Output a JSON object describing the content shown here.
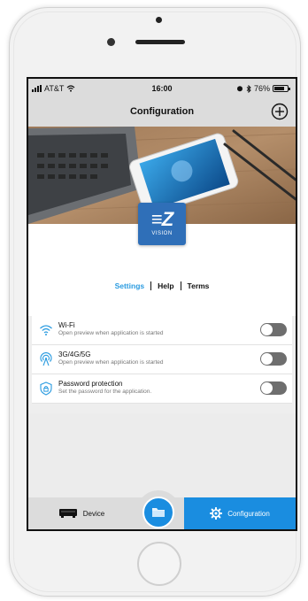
{
  "status_bar": {
    "carrier": "AT&T",
    "time": "16:00",
    "battery": "76%",
    "battery_level": 0.76
  },
  "header": {
    "title": "Configuration",
    "add_icon": "plus-circle-icon"
  },
  "logo": {
    "main": "≡Z",
    "sub": "VISION"
  },
  "tabs": [
    {
      "label": "Settings",
      "active": true
    },
    {
      "label": "Help",
      "active": false
    },
    {
      "label": "Terms",
      "active": false
    }
  ],
  "settings": [
    {
      "title": "Wi-Fi",
      "subtitle": "Open preview when application is started",
      "icon": "wifi-icon",
      "enabled": false
    },
    {
      "title": "3G/4G/5G",
      "subtitle": "Open preview when application is started",
      "icon": "cellular-icon",
      "enabled": false
    },
    {
      "title": "Password protection",
      "subtitle": "Set the password for the application.",
      "icon": "lock-icon",
      "enabled": false
    }
  ],
  "bottom_nav": {
    "device_label": "Device",
    "configuration_label": "Configuration",
    "center_icon": "folder-icon"
  },
  "colors": {
    "accent": "#1a8de0",
    "tab_active": "#2a9be0",
    "logo_bg": "#2f6fb8",
    "toggle_off": "#6e6e6e"
  }
}
